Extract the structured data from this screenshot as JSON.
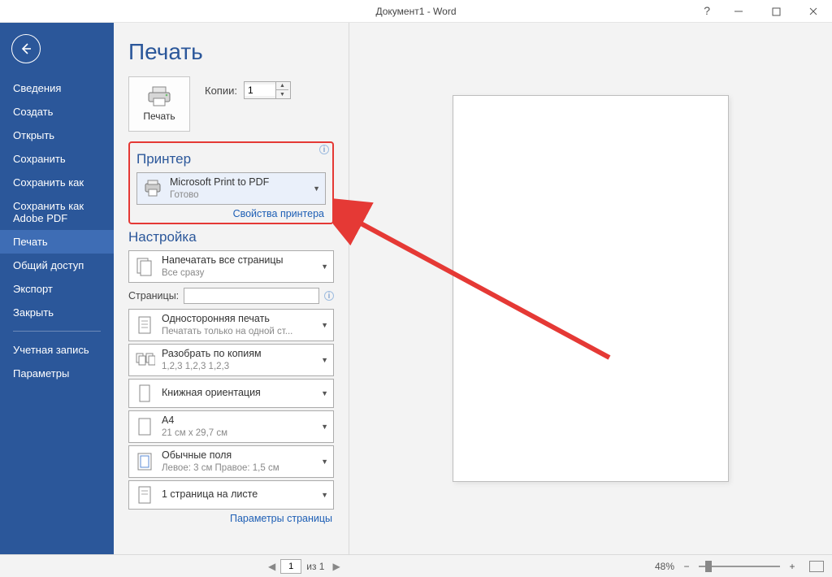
{
  "titlebar": {
    "title": "Документ1 - Word"
  },
  "sidebar": {
    "items": [
      "Сведения",
      "Создать",
      "Открыть",
      "Сохранить",
      "Сохранить как",
      "Сохранить как Adobe PDF",
      "Печать",
      "Общий доступ",
      "Экспорт",
      "Закрыть"
    ],
    "footer": [
      "Учетная запись",
      "Параметры"
    ],
    "activeIndex": 6
  },
  "page": {
    "title": "Печать",
    "printButton": "Печать",
    "copiesLabel": "Копии:",
    "copiesValue": "1"
  },
  "printer": {
    "header": "Принтер",
    "name": "Microsoft Print to PDF",
    "status": "Готово",
    "propertiesLink": "Свойства принтера"
  },
  "settings": {
    "header": "Настройка",
    "printAll": {
      "title": "Напечатать все страницы",
      "sub": "Все сразу"
    },
    "pagesLabel": "Страницы:",
    "pagesValue": "",
    "oneSided": {
      "title": "Односторонняя печать",
      "sub": "Печатать только на одной ст..."
    },
    "collate": {
      "title": "Разобрать по копиям",
      "sub": "1,2,3    1,2,3    1,2,3"
    },
    "orientation": {
      "title": "Книжная ориентация",
      "sub": ""
    },
    "paper": {
      "title": "A4",
      "sub": "21 см x 29,7 см"
    },
    "margins": {
      "title": "Обычные поля",
      "sub": "Левое:  3 см    Правое:  1,5 см"
    },
    "perSheet": {
      "title": "1 страница на листе",
      "sub": ""
    },
    "pageSetupLink": "Параметры страницы"
  },
  "statusbar": {
    "pageNum": "1",
    "ofLabel": "из 1",
    "zoom": "48%"
  }
}
